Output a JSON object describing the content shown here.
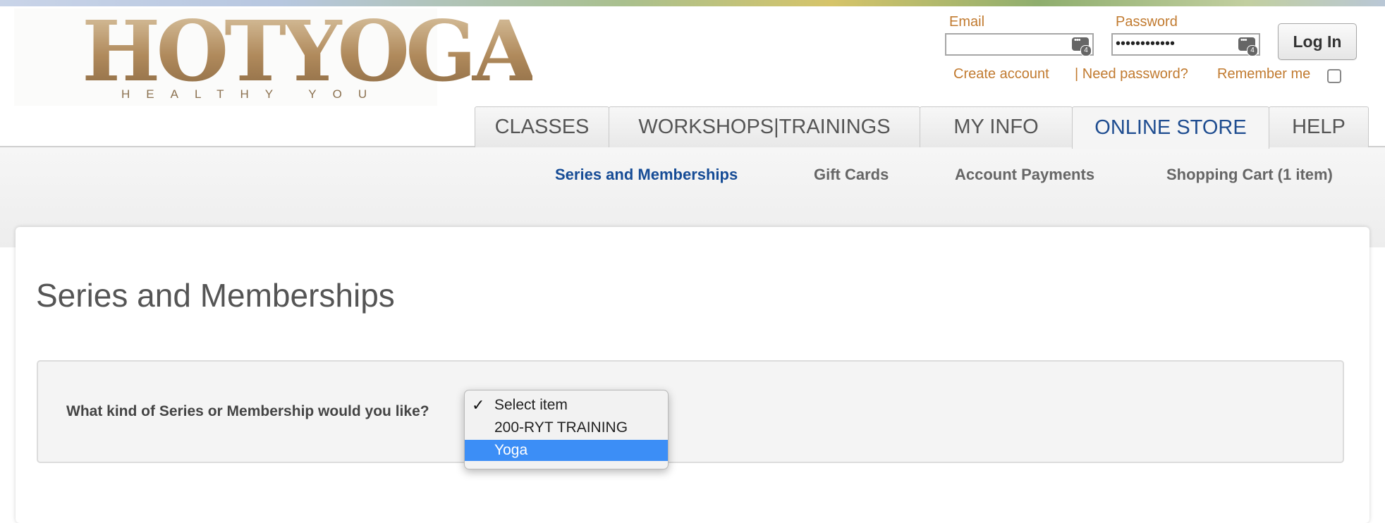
{
  "brand": {
    "logo_text": "HOTYOGA",
    "tagline": "HEALTHY YOU",
    "colors": {
      "gold": "#b8966a",
      "accent_orange": "#c17a2f",
      "link_blue": "#164c96",
      "highlight": "#3c8ef6"
    }
  },
  "login": {
    "email_label": "Email",
    "email_value": "",
    "password_label": "Password",
    "password_value": "••••••••••••",
    "login_button": "Log In",
    "create_account": "Create account",
    "need_password": "| Need password?",
    "remember_me": "Remember me",
    "remember_checked": false,
    "field_icon": "password-key-icon"
  },
  "tabs": [
    {
      "label": "CLASSES",
      "active": false
    },
    {
      "label": "WORKSHOPS|TRAININGS",
      "active": false
    },
    {
      "label": "MY INFO",
      "active": false
    },
    {
      "label": "ONLINE STORE",
      "active": true
    },
    {
      "label": "HELP",
      "active": false
    }
  ],
  "subnav": [
    {
      "label": "Series and Memberships",
      "active": true
    },
    {
      "label": "Gift Cards",
      "active": false
    },
    {
      "label": "Account Payments",
      "active": false
    },
    {
      "label": "Shopping Cart (1 item)",
      "active": false
    }
  ],
  "main": {
    "title": "Series and Memberships",
    "question": "What kind of Series or Membership would you like?",
    "dropdown": {
      "options": [
        "Select item",
        "200-RYT TRAINING",
        "Yoga"
      ],
      "checked": "Select item",
      "highlighted": "Yoga"
    }
  }
}
